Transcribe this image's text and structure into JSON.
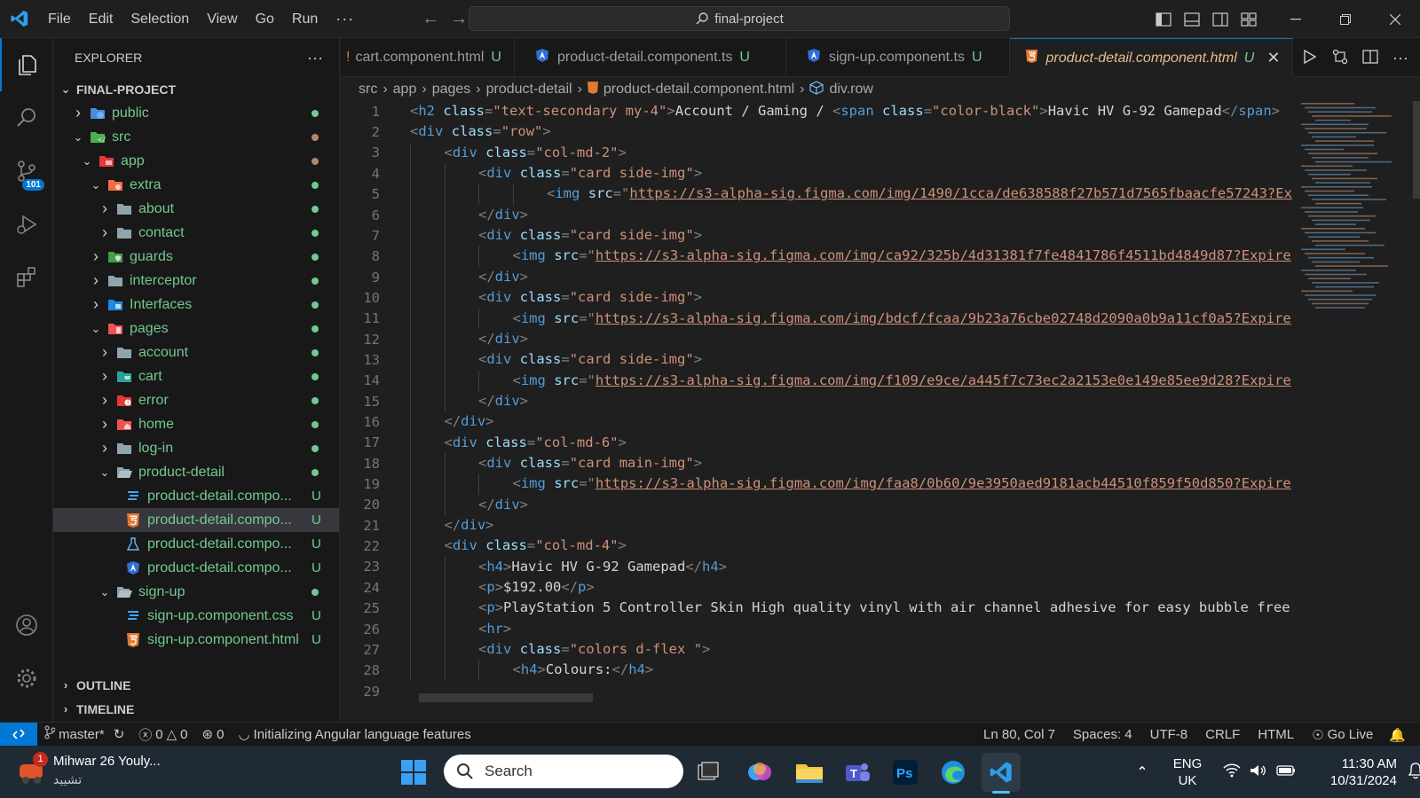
{
  "titlebar": {
    "menu": [
      "File",
      "Edit",
      "Selection",
      "View",
      "Go",
      "Run"
    ],
    "more": "···",
    "search_text": "final-project"
  },
  "activity": {
    "scm_badge": "101"
  },
  "explorer": {
    "title": "EXPLORER",
    "more": "···",
    "root": "FINAL-PROJECT",
    "items": [
      {
        "label": "public",
        "status": "dot",
        "icon": "folder-public-icon"
      },
      {
        "label": "src",
        "status": "dot-brown",
        "icon": "folder-src-icon"
      },
      {
        "label": "app",
        "status": "dot-brown",
        "icon": "folder-app-icon"
      },
      {
        "label": "extra",
        "status": "dot",
        "icon": "folder-extra-icon"
      },
      {
        "label": "about",
        "status": "dot",
        "icon": "folder-icon"
      },
      {
        "label": "contact",
        "status": "dot",
        "icon": "folder-icon"
      },
      {
        "label": "guards",
        "status": "dot",
        "icon": "folder-guards-icon"
      },
      {
        "label": "interceptor",
        "status": "dot",
        "icon": "folder-icon"
      },
      {
        "label": "Interfaces",
        "status": "dot",
        "icon": "folder-interfaces-icon"
      },
      {
        "label": "pages",
        "status": "dot",
        "icon": "folder-pages-icon"
      },
      {
        "label": "account",
        "status": "dot",
        "icon": "folder-icon"
      },
      {
        "label": "cart",
        "status": "dot",
        "icon": "folder-cart-icon"
      },
      {
        "label": "error",
        "status": "dot",
        "icon": "folder-error-icon"
      },
      {
        "label": "home",
        "status": "dot",
        "icon": "folder-home-icon"
      },
      {
        "label": "log-in",
        "status": "dot",
        "icon": "folder-icon"
      },
      {
        "label": "product-detail",
        "status": "dot",
        "icon": "folder-open-icon"
      },
      {
        "label": "product-detail.compo...",
        "status": "U",
        "icon": "css-file-icon"
      },
      {
        "label": "product-detail.compo...",
        "status": "U",
        "icon": "html-file-icon"
      },
      {
        "label": "product-detail.compo...",
        "status": "U",
        "icon": "test-file-icon"
      },
      {
        "label": "product-detail.compo...",
        "status": "U",
        "icon": "angular-file-icon"
      },
      {
        "label": "sign-up",
        "status": "dot",
        "icon": "folder-open-icon"
      },
      {
        "label": "sign-up.component.css",
        "status": "U",
        "icon": "css-file-icon"
      },
      {
        "label": "sign-up.component.html",
        "status": "U",
        "icon": "html-file-icon"
      }
    ],
    "outline": "OUTLINE",
    "timeline": "TIMELINE"
  },
  "tabs": [
    {
      "label": "cart.component.html",
      "status": "U"
    },
    {
      "label": "product-detail.component.ts",
      "status": "U"
    },
    {
      "label": "sign-up.component.ts",
      "status": "U"
    },
    {
      "label": "product-detail.component.html",
      "status": "U"
    }
  ],
  "breadcrumb": [
    "src",
    "app",
    "pages",
    "product-detail",
    "product-detail.component.html",
    "div.row"
  ],
  "code": {
    "line_numbers": [
      "1",
      "2",
      "3",
      "4",
      "5",
      "6",
      "7",
      "8",
      "9",
      "10",
      "11",
      "12",
      "13",
      "14",
      "15",
      "16",
      "17",
      "18",
      "19",
      "20",
      "21",
      "22",
      "23",
      "24",
      "25",
      "26",
      "27",
      "28",
      "29"
    ],
    "line1": {
      "h2": "h2",
      "class_attr": "class",
      "class_val": "\"text-secondary my-4\"",
      "text": "Account / Gaming / ",
      "span": "span",
      "span_class": "\"color-black\"",
      "span_text": "Havic HV G-92 Gamepad",
      "span_close": "span"
    },
    "div": "div",
    "img": "img",
    "h4": "h4",
    "p": "p",
    "hr": "hr",
    "class_attr": "class",
    "src_attr": "src",
    "val_row": "\"row\"",
    "val_col2": "\"col-md-2\"",
    "val_side": "\"card side-img\"",
    "val_col6": "\"col-md-6\"",
    "val_main": "\"card main-img\"",
    "val_col4": "\"col-md-4\"",
    "val_colors": "\"colors d-flex \"",
    "url1": "https://s3-alpha-sig.figma.com/img/1490/1cca/de638588f27b571d7565fbaacfe57243?Ex",
    "url2": "https://s3-alpha-sig.figma.com/img/ca92/325b/4d31381f7fe4841786f4511bd4849d87?Expire",
    "url3": "https://s3-alpha-sig.figma.com/img/bdcf/fcaa/9b23a76cbe02748d2090a0b9a11cf0a5?Expire",
    "url4": "https://s3-alpha-sig.figma.com/img/f109/e9ce/a445f7c73ec2a2153e0e149e85ee9d28?Expire",
    "url5": "https://s3-alpha-sig.figma.com/img/faa8/0b60/9e3950aed9181acb44510f859f50d850?Expire",
    "h4_text": "Havic HV G-92 Gamepad",
    "price": "$192.00",
    "desc": "PlayStation 5 Controller Skin High quality vinyl with air channel adhesive for easy bubble free",
    "colours": "Colours:"
  },
  "statusbar": {
    "branch": "master*",
    "errors": "0",
    "warnings": "0",
    "ports": "0",
    "task": "Initializing Angular language features",
    "position": "Ln 80, Col 7",
    "spaces": "Spaces: 4",
    "encoding": "UTF-8",
    "eol": "CRLF",
    "language": "HTML",
    "golive": "Go Live"
  },
  "taskbar": {
    "notif_title": "Mihwar 26 Youly...",
    "notif_sub": "تشييد",
    "notif_badge": "1",
    "search": "Search",
    "lang_top": "ENG",
    "lang_bottom": "UK",
    "time": "11:30 AM",
    "date": "10/31/2024"
  },
  "colors": {
    "accent": "#0078d4",
    "untracked": "#73c991",
    "html_orange": "#e37933"
  }
}
